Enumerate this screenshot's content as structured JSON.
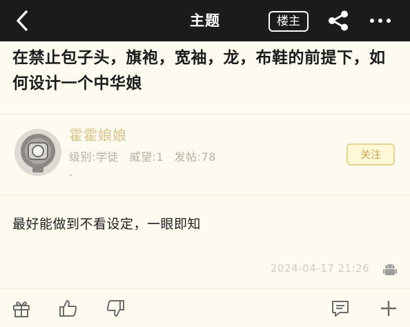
{
  "nav": {
    "title": "主题",
    "op_badge": "楼主"
  },
  "post": {
    "title": "在禁止包子头，旗袍，宽袖，龙，布鞋的前提下，如何设计一个中华娘",
    "author": {
      "name": "霍霍娘娘",
      "stats": [
        "级别:学徒",
        "威望:1",
        "发帖:78"
      ],
      "extra": "-",
      "follow_label": "关注"
    },
    "body": "最好能做到不看设定，一眼即知",
    "time": "2024-04-17 21:26"
  },
  "colors": {
    "topbar_bg": "#1b1b1b",
    "page_bg": "#fdfaf0",
    "author_name": "#d9c48a",
    "follow_accent": "#c9a94f"
  },
  "icons": {
    "back": "chevron-left-icon",
    "share": "share-icon",
    "more": "more-dots-icon",
    "avatar": "diving-helmet-avatar",
    "device": "android-icon",
    "actions": [
      "gift-icon",
      "thumbs-up-icon",
      "thumbs-down-icon",
      "comment-icon",
      "plus-icon"
    ]
  }
}
